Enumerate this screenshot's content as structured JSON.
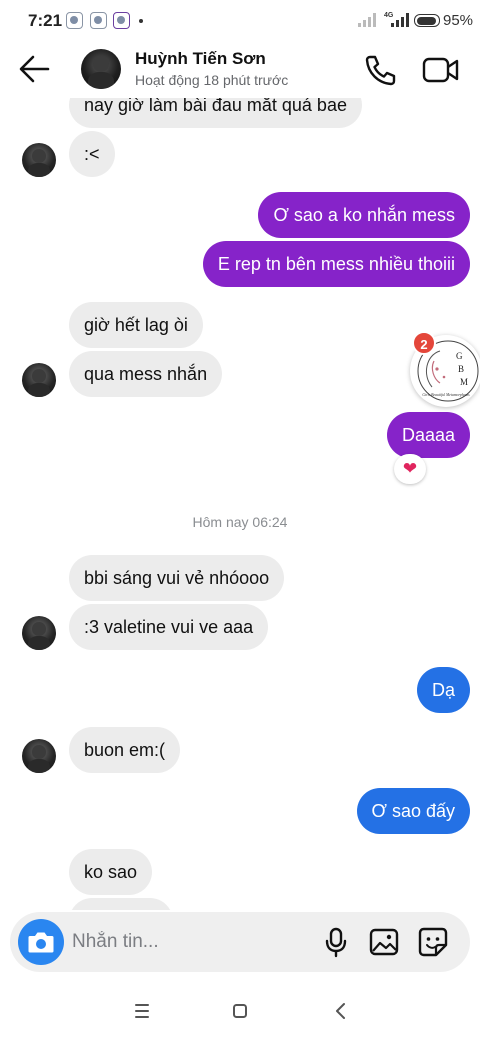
{
  "status_bar": {
    "time": "7:21",
    "network": "4G",
    "battery_percent": "95%",
    "battery_level": 0.95
  },
  "header": {
    "contact_name": "Huỳnh Tiến Sơn",
    "activity": "Hoạt động 18 phút trước",
    "icons": [
      "back-arrow-icon",
      "phone-icon",
      "video-camera-icon"
    ]
  },
  "chat": {
    "messages": [
      {
        "direction": "in",
        "text": "nay giờ làm bài đau mắt quá bae"
      },
      {
        "direction": "in",
        "text": ":<"
      },
      {
        "direction": "out",
        "text": "Ơ sao a ko nhắn mess"
      },
      {
        "direction": "out",
        "text": "E rep tn bên mess nhiều thoiii"
      },
      {
        "direction": "in",
        "text": "giờ hết lag òi"
      },
      {
        "direction": "in",
        "text": "qua mess nhắn"
      },
      {
        "direction": "out",
        "text": "Daaaa",
        "reaction": "❤"
      },
      {
        "direction": "in",
        "text": "bbi sáng vui vẻ nhóooo"
      },
      {
        "direction": "in",
        "text": ":3 valetine vui ve aaa"
      },
      {
        "direction": "out",
        "text": "Dạ"
      },
      {
        "direction": "in",
        "text": "buon em:("
      },
      {
        "direction": "out",
        "text": "Ơ sao đấy"
      },
      {
        "direction": "in",
        "text": "ko sao"
      }
    ],
    "date_separator": "Hôm nay 06:24"
  },
  "chathead": {
    "badge_count": "2",
    "logo_letters": [
      "G",
      "B",
      "M"
    ],
    "logo_caption": "Girls Beautiful Metamorphosis"
  },
  "composer": {
    "placeholder": "Nhắn tin...",
    "icons": [
      "camera-icon",
      "microphone-icon",
      "gallery-icon",
      "sticker-icon"
    ]
  },
  "nav_bar": {
    "icons": [
      "menu-icon",
      "home-square-icon",
      "back-chevron-icon"
    ]
  },
  "colors": {
    "outgoing_purple": "#8623c9",
    "outgoing_blue": "#2471e5",
    "incoming_gray": "#ececec",
    "camera_blue": "#2a86f0",
    "badge_red": "#e4463a"
  }
}
